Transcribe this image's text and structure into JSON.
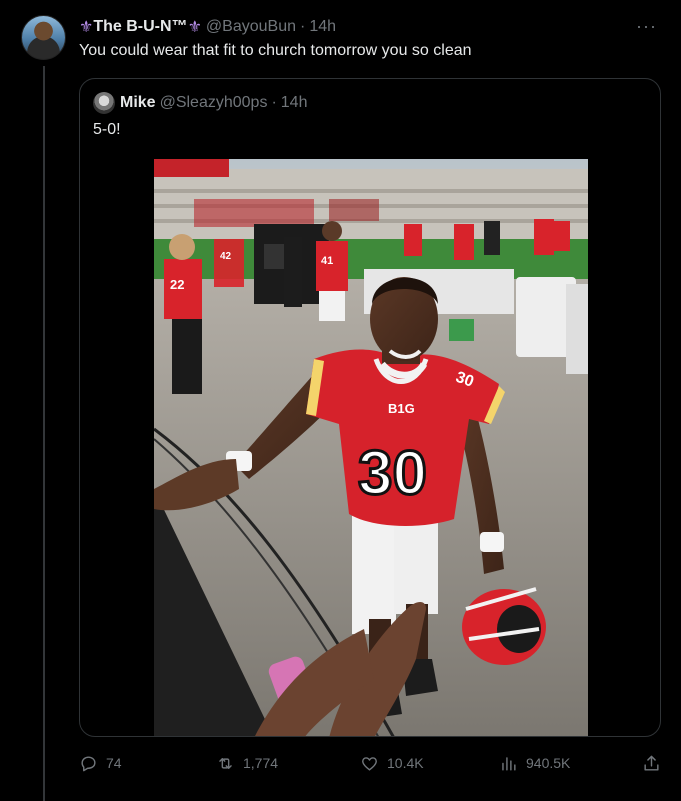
{
  "tweet": {
    "display_name": "The B-U-N™",
    "fleur_symbol": "⚜",
    "handle": "@BayouBun",
    "separator": "·",
    "time": "14h",
    "more": "···",
    "text": "You could wear that fit to church tomorrow you so clean"
  },
  "quote": {
    "display_name": "Mike",
    "handle": "@Sleazyh00ps",
    "separator": "·",
    "time": "14h",
    "text": "5-0!",
    "photo_text": {
      "jersey_number": "30",
      "conference": "B1G",
      "sleeve_number": "30",
      "bg_player_1": "22",
      "bg_player_2": "41",
      "bg_player_3": "42"
    }
  },
  "actions": {
    "replies": "74",
    "retweets": "1,774",
    "likes": "10.4K",
    "views": "940.5K"
  },
  "colors": {
    "background": "#000000",
    "text": "#e7e9ea",
    "muted": "#71767b",
    "border": "#2f3336",
    "jersey_red": "#d6222b"
  },
  "icons": [
    "reply-icon",
    "retweet-icon",
    "like-icon",
    "views-icon",
    "share-icon",
    "more-icon"
  ]
}
